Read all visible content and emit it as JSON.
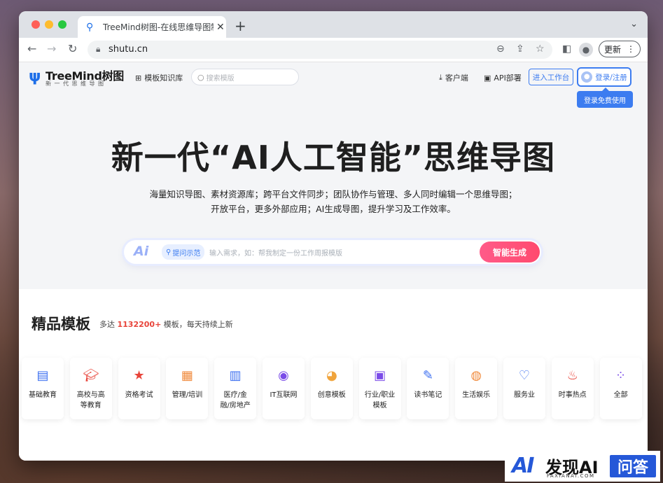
{
  "browser": {
    "tab_title": "TreeMind树图-在线思维导图制作",
    "url": "shutu.cn",
    "update_label": "更新"
  },
  "header": {
    "logo_name": "TreeMind树图",
    "logo_sub": "新一代思维导图",
    "templates_link": "模板知识库",
    "search_placeholder": "搜索模版",
    "client_link": "客户端",
    "api_link": "API部署",
    "enter_button": "进入工作台",
    "login_button": "登录/注册",
    "login_tooltip": "登录免费使用"
  },
  "hero": {
    "title": "新一代“AI人工智能”思维导图",
    "subtitle_line1": "海量知识导图、素材资源库；跨平台文件同步；团队协作与管理、多人同时编辑一个思维导图；",
    "subtitle_line2": "开放平台，更多外部应用；AI生成导图，提升学习及工作效率。"
  },
  "ai_bar": {
    "logo": "Ai",
    "demo_label": "提问示范",
    "input_placeholder": "输入需求，如：帮我制定一份工作周报模版",
    "generate_button": "智能生成"
  },
  "section": {
    "title": "精品模板",
    "sub_prefix": "多达",
    "count": "1132200+",
    "sub_suffix": "模板，每天持续上新"
  },
  "categories": [
    {
      "label": "基础教育",
      "icon": "book-icon",
      "color": "#3c6ff0"
    },
    {
      "label": "高校与高等教育",
      "icon": "graduation-cap-icon",
      "color": "#e8443a"
    },
    {
      "label": "资格考试",
      "icon": "certificate-icon",
      "color": "#e8443a"
    },
    {
      "label": "管理/培训",
      "icon": "whiteboard-icon",
      "color": "#f08a3c"
    },
    {
      "label": "医疗/金融/房地产",
      "icon": "building-icon",
      "color": "#3c6ff0"
    },
    {
      "label": "IT互联网",
      "icon": "planet-icon",
      "color": "#7a4be8"
    },
    {
      "label": "创意模板",
      "icon": "lightbulb-icon",
      "color": "#f0a43c"
    },
    {
      "label": "行业/职业模板",
      "icon": "briefcase-icon",
      "color": "#7a4be8"
    },
    {
      "label": "读书笔记",
      "icon": "notebook-icon",
      "color": "#3c6ff0"
    },
    {
      "label": "生活娱乐",
      "icon": "gamepad-icon",
      "color": "#f08a3c"
    },
    {
      "label": "服务业",
      "icon": "service-icon",
      "color": "#3c6ff0"
    },
    {
      "label": "时事热点",
      "icon": "flame-icon",
      "color": "#e8443a"
    },
    {
      "label": "全部",
      "icon": "grid-icon",
      "color": "#7a4be8"
    }
  ],
  "watermark": {
    "logo": "AI",
    "text": "发现AI",
    "url": "FAXIANAI.COM",
    "badge": "问答"
  }
}
